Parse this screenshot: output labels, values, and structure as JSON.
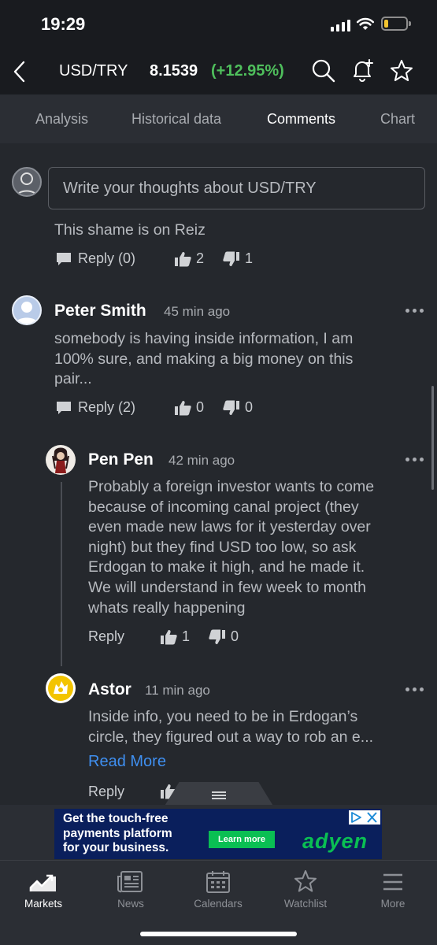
{
  "status_bar": {
    "time": "19:29",
    "battery_level": 0.2,
    "battery_color": "#f4c430",
    "icons": [
      "signal-icon",
      "wifi-icon",
      "battery-icon"
    ]
  },
  "header": {
    "symbol": "USD/TRY",
    "price": "8.1539",
    "change": "(+12.95%)",
    "change_color": "#4fbf5c",
    "icons": [
      "back-chevron-icon",
      "search-icon",
      "bell-add-icon",
      "star-icon"
    ]
  },
  "tabs": [
    {
      "label": "Analysis",
      "active": false
    },
    {
      "label": "Historical data",
      "active": false
    },
    {
      "label": "Comments",
      "active": true
    },
    {
      "label": "Chart",
      "active": false
    }
  ],
  "composer": {
    "placeholder": "Write your thoughts about USD/TRY"
  },
  "comments": [
    {
      "text": "This shame is on Reiz",
      "reply_label": "Reply (0)",
      "likes": "2",
      "dislikes": "1"
    },
    {
      "author": "Peter Smith",
      "time_ago": "45 min ago",
      "text_lines": [
        "somebody is having inside information, I am",
        "100% sure, and making a big money on this",
        "pair..."
      ],
      "reply_label": "Reply (2)",
      "likes": "0",
      "dislikes": "0",
      "replies": [
        {
          "author": "Pen Pen",
          "time_ago": "42 min ago",
          "text_lines": [
            "Probably a foreign investor wants to come",
            "because of incoming canal project (they",
            "even made new laws for it yesterday over",
            "night) but they find USD too low, so ask",
            "Erdogan to make it high, and he made it.",
            "We will understand in few week to month",
            "whats really happening"
          ],
          "reply_label": "Reply",
          "likes": "1",
          "dislikes": "0"
        },
        {
          "author": "Astor",
          "time_ago": "11 min ago",
          "text_lines": [
            "Inside info, you need to be in Erdogan’s",
            "circle, they figured out a way to rob an e..."
          ],
          "read_more": "Read More",
          "reply_label": "Reply"
        }
      ]
    }
  ],
  "ad": {
    "text_lines": [
      "Get the touch-free",
      "payments platform",
      "for your business."
    ],
    "button": "Learn more",
    "logo": "adyen",
    "brand_color": "#0abf53",
    "background": "#0a1f5c"
  },
  "bottom_nav": [
    {
      "label": "Markets",
      "icon": "markets-chart-icon",
      "active": true
    },
    {
      "label": "News",
      "icon": "news-icon",
      "active": false
    },
    {
      "label": "Calendars",
      "icon": "calendar-icon",
      "active": false
    },
    {
      "label": "Watchlist",
      "icon": "star-icon",
      "active": false
    },
    {
      "label": "More",
      "icon": "menu-icon",
      "active": false
    }
  ]
}
